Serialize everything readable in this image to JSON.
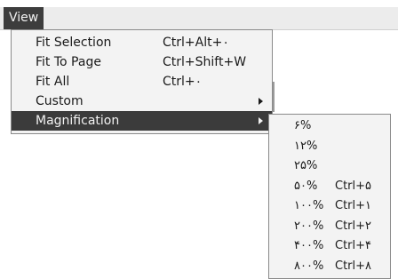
{
  "menubar": {
    "view_label": "View"
  },
  "view_menu": {
    "items": [
      {
        "label": "Fit Selection",
        "shortcut": "Ctrl+Alt+٠"
      },
      {
        "label": "Fit To Page",
        "shortcut": "Ctrl+Shift+W"
      },
      {
        "label": "Fit All",
        "shortcut": "Ctrl+٠"
      },
      {
        "label": "Custom",
        "shortcut": ""
      },
      {
        "label": "Magnification",
        "shortcut": ""
      }
    ]
  },
  "magnification_menu": {
    "items": [
      {
        "label": "۶%",
        "shortcut": ""
      },
      {
        "label": "۱۲%",
        "shortcut": ""
      },
      {
        "label": "۲۵%",
        "shortcut": ""
      },
      {
        "label": "۵۰%",
        "shortcut": "Ctrl+۵"
      },
      {
        "label": "۱۰۰%",
        "shortcut": "Ctrl+۱"
      },
      {
        "label": "۲۰۰%",
        "shortcut": "Ctrl+۲"
      },
      {
        "label": "۴۰۰%",
        "shortcut": "Ctrl+۴"
      },
      {
        "label": "۸۰۰%",
        "shortcut": "Ctrl+۸"
      }
    ]
  },
  "colors": {
    "highlight_bg": "#3b3b3b",
    "menu_bg": "#f3f3f3"
  }
}
